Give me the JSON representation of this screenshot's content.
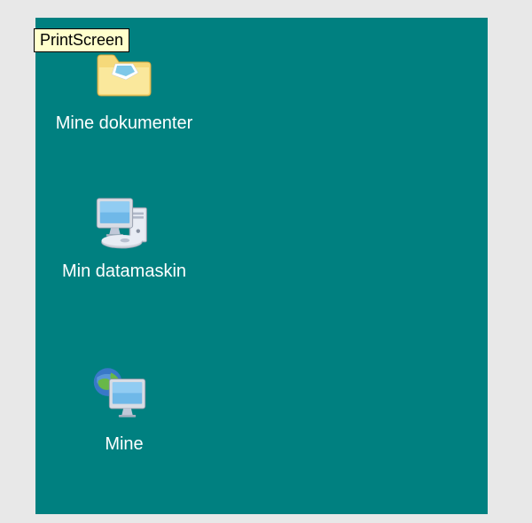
{
  "tooltip": {
    "text": "PrintScreen"
  },
  "desktop": {
    "icons": [
      {
        "label": "Mine dokumenter"
      },
      {
        "label": "Min datamaskin"
      },
      {
        "label": "Mine"
      }
    ]
  }
}
